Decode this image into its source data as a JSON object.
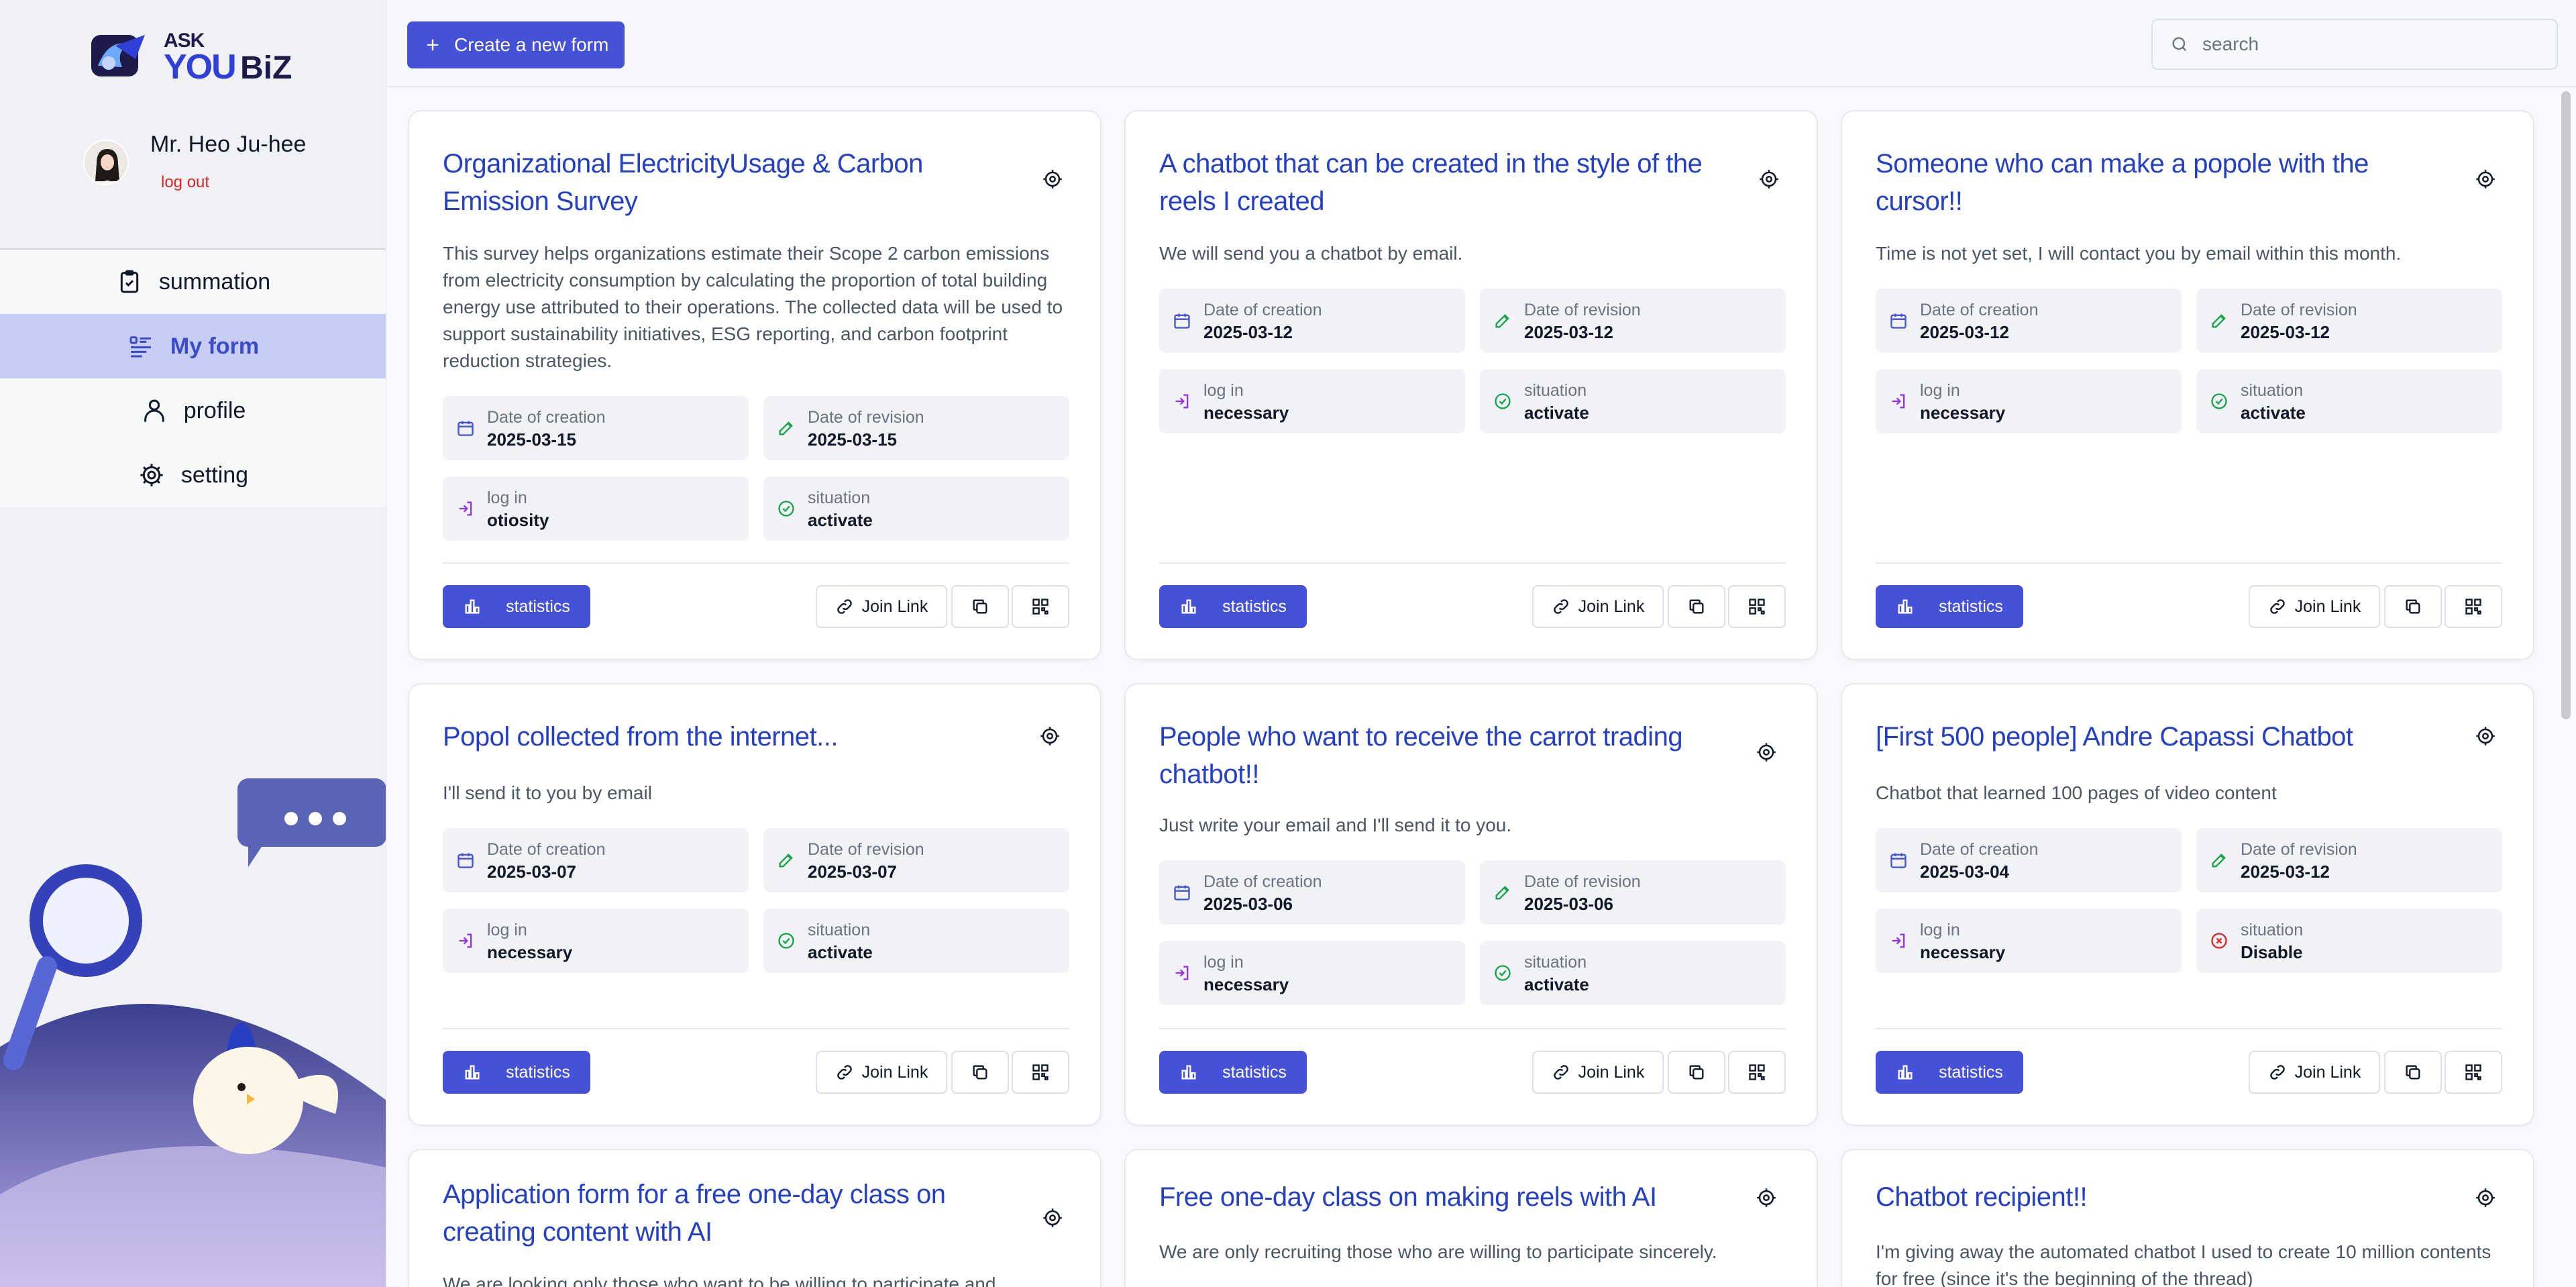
{
  "brand": {
    "ask": "ASK",
    "you": "YOU",
    "biz": "BiZ"
  },
  "user": {
    "name": "Mr. Heo Ju-hee",
    "logout": "log out"
  },
  "nav": [
    {
      "label": "summation",
      "icon": "clipboard-icon"
    },
    {
      "label": "My form",
      "icon": "list-icon",
      "active": true
    },
    {
      "label": "profile",
      "icon": "person-icon"
    },
    {
      "label": "setting",
      "icon": "gear-icon"
    }
  ],
  "toolbar": {
    "create_label": "Create a new form",
    "search_placeholder": "search"
  },
  "labels": {
    "created": "Date of creation",
    "revised": "Date of revision",
    "login": "log in",
    "situation": "situation",
    "statistics": "statistics",
    "join": "Join Link"
  },
  "cards": [
    {
      "title": "Organizational ElectricityUsage & Carbon Emission Survey",
      "desc": "This survey helps organizations estimate their Scope 2 carbon emissions from electricity consumption by calculating the proportion of total building energy use attributed to their operations. The collected data will be used to support sustainability initiatives, ESG reporting, and carbon footprint reduction strategies.",
      "created": "2025-03-15",
      "revised": "2025-03-15",
      "login": "otiosity",
      "situation": "activate"
    },
    {
      "title": "A chatbot that can be created in the style of the reels I created",
      "desc": "We will send you a chatbot by email.",
      "created": "2025-03-12",
      "revised": "2025-03-12",
      "login": "necessary",
      "situation": "activate"
    },
    {
      "title": "Someone who can make a popole with the cursor!!",
      "desc": "Time is not yet set, I will contact you by email within this month.",
      "created": "2025-03-12",
      "revised": "2025-03-12",
      "login": "necessary",
      "situation": "activate"
    },
    {
      "title": "Popol collected from the internet...",
      "desc": "I'll send it to you by email",
      "created": "2025-03-07",
      "revised": "2025-03-07",
      "login": "necessary",
      "situation": "activate"
    },
    {
      "title": "People who want to receive the carrot trading chatbot!!",
      "desc": "Just write your email and I'll send it to you.",
      "created": "2025-03-06",
      "revised": "2025-03-06",
      "login": "necessary",
      "situation": "activate"
    },
    {
      "title": "[First 500 people] Andre Capassi Chatbot",
      "desc": "Chatbot that learned 100 pages of video content",
      "created": "2025-03-04",
      "revised": "2025-03-12",
      "login": "necessary",
      "situation": "Disable"
    },
    {
      "title": "Application form for a free one-day class on creating content with AI",
      "desc": "We are looking only those who want to be willing to participate and.",
      "created": "",
      "revised": "",
      "login": "",
      "situation": ""
    },
    {
      "title": "Free one-day class on making reels with AI",
      "desc": "We are only recruiting those who are willing to participate sincerely.",
      "created": "",
      "revised": "",
      "login": "",
      "situation": ""
    },
    {
      "title": "Chatbot recipient!!",
      "desc": "I'm giving away the automated chatbot I used to create 10 million contents for free (since it's the beginning of the thread)",
      "created": "",
      "revised": "",
      "login": "",
      "situation": ""
    }
  ],
  "colors": {
    "accent": "#4551d6",
    "title": "#2540c2",
    "active_nav": "#c7cdf4",
    "logout": "#dc2626",
    "disable": "#dc2626",
    "activate": "#16a34a"
  }
}
